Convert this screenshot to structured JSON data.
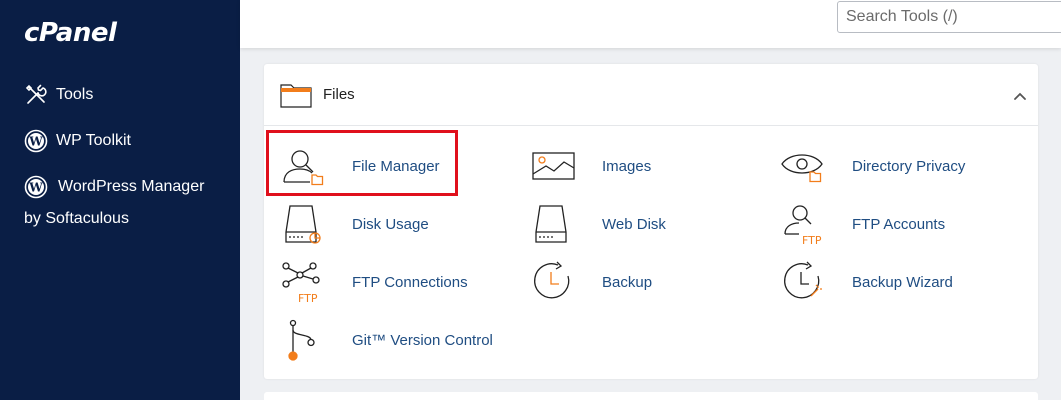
{
  "brand": {
    "logo_text": "cPanel"
  },
  "sidebar": {
    "items": [
      {
        "label": "Tools",
        "icon": "tools-icon"
      },
      {
        "label": "WP Toolkit",
        "icon": "wordpress-icon"
      },
      {
        "label": "WordPress Manager",
        "label_line2": "by Softaculous",
        "icon": "wordpress-icon"
      }
    ]
  },
  "search": {
    "placeholder": "Search Tools (/)"
  },
  "files_section": {
    "title": "Files",
    "tools": [
      {
        "label": "File Manager",
        "icon": "file-manager-icon",
        "highlighted": true
      },
      {
        "label": "Images",
        "icon": "images-icon"
      },
      {
        "label": "Directory Privacy",
        "icon": "directory-privacy-icon"
      },
      {
        "label": "Disk Usage",
        "icon": "disk-usage-icon"
      },
      {
        "label": "Web Disk",
        "icon": "web-disk-icon"
      },
      {
        "label": "FTP Accounts",
        "icon": "ftp-accounts-icon",
        "badge": "FTP"
      },
      {
        "label": "FTP Connections",
        "icon": "ftp-connections-icon",
        "badge": "FTP"
      },
      {
        "label": "Backup",
        "icon": "backup-icon"
      },
      {
        "label": "Backup Wizard",
        "icon": "backup-wizard-icon"
      },
      {
        "label": "Git™ Version Control",
        "icon": "git-icon"
      }
    ]
  },
  "colors": {
    "sidebar_bg": "#0a1e45",
    "accent": "#f27d1b",
    "link": "#1f4d82",
    "highlight": "#e0101c"
  }
}
